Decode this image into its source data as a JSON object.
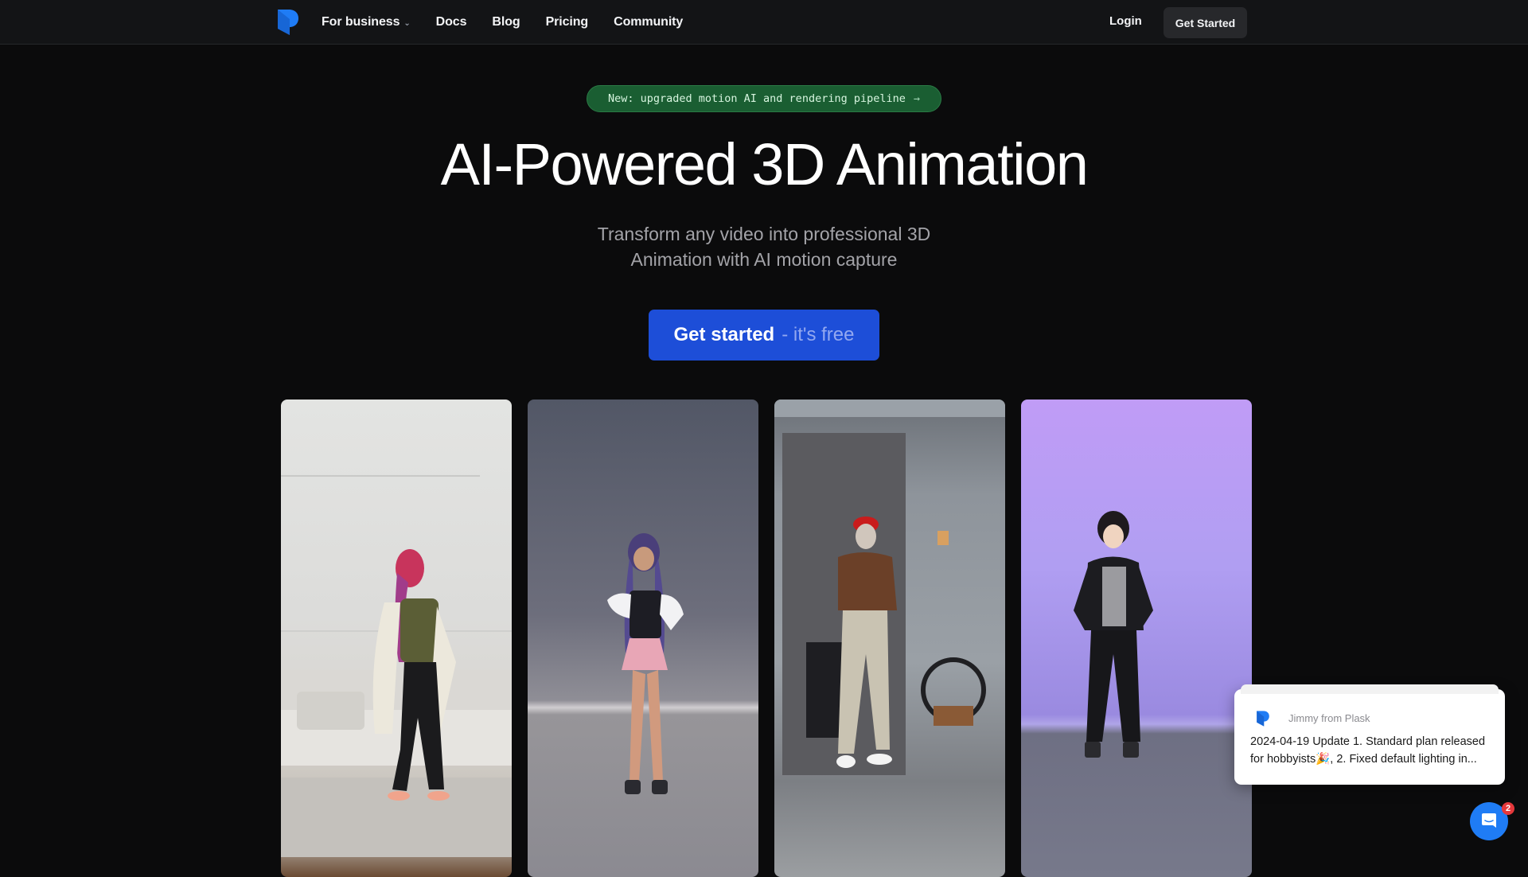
{
  "nav": {
    "logo": "plask-logo-icon",
    "links": [
      {
        "label": "For business",
        "has_dropdown": true
      },
      {
        "label": "Docs"
      },
      {
        "label": "Blog"
      },
      {
        "label": "Pricing"
      },
      {
        "label": "Community"
      }
    ],
    "dropdown_icon": "chevron-down-icon",
    "login_label": "Login",
    "get_started_label": "Get Started"
  },
  "hero": {
    "announcement": "New: upgraded motion AI and rendering pipeline",
    "announcement_arrow": "→",
    "title": "AI-Powered 3D Animation",
    "subtitle_line1": "Transform any video into professional 3D",
    "subtitle_line2": "Animation with AI motion capture",
    "cta_strong": "Get started",
    "cta_light": "- it's free"
  },
  "showcase": [
    {
      "name": "woman-dancing-video",
      "kind": "real video"
    },
    {
      "name": "anime-girl-3d-avatar",
      "kind": "3D animation"
    },
    {
      "name": "man-dancing-video",
      "kind": "real video"
    },
    {
      "name": "anime-boy-3d-avatar",
      "kind": "3D animation"
    }
  ],
  "colors": {
    "brand_blue": "#1f7cf5",
    "cta_blue": "#1d4ed8",
    "badge_green": "#1a5e32",
    "notification_red": "#e5383b"
  },
  "chat": {
    "sender": "Jimmy from Plask",
    "message": "2024-04-19 Update 1. Standard plan released for hobbyists🎉, 2. Fixed default lighting in...",
    "unread_count": "2"
  }
}
